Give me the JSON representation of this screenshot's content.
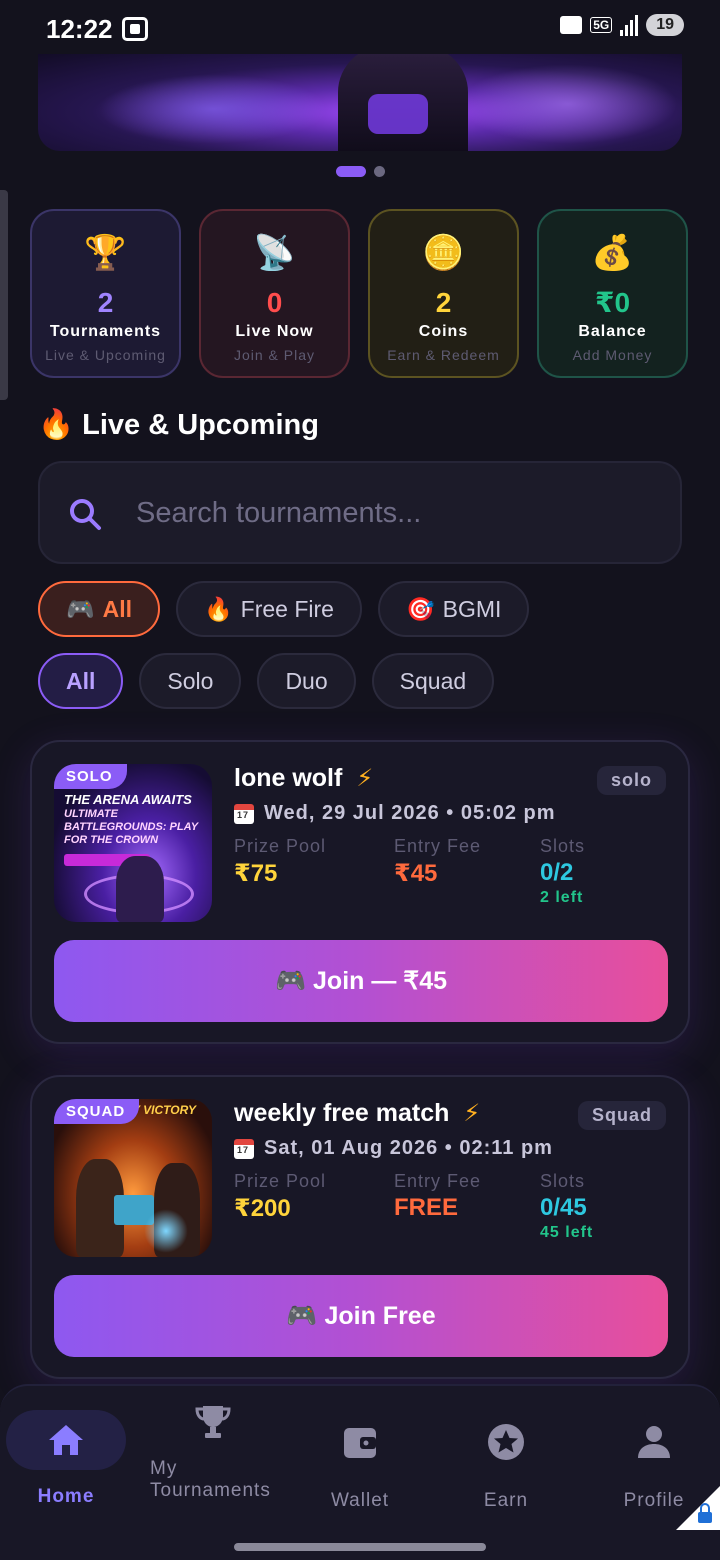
{
  "status_bar": {
    "time": "12:22",
    "network": "5G",
    "battery": "19"
  },
  "banner": {
    "slide_count": 2,
    "active_slide": 1
  },
  "stats": [
    {
      "icon": "trophy-icon",
      "emoji": "🏆",
      "value": "2",
      "label": "Tournaments",
      "sub": "Live & Upcoming",
      "color": "#a084ff"
    },
    {
      "icon": "satellite-icon",
      "emoji": "📡",
      "value": "0",
      "label": "Live Now",
      "sub": "Join & Play",
      "color": "#ff4d4d"
    },
    {
      "icon": "coin-icon",
      "emoji": "🪙",
      "value": "2",
      "label": "Coins",
      "sub": "Earn & Redeem",
      "color": "#ffd43b"
    },
    {
      "icon": "money-bag-icon",
      "emoji": "💰",
      "value": "₹0",
      "label": "Balance",
      "sub": "Add Money",
      "color": "#22c58b"
    }
  ],
  "section": {
    "emoji": "🔥",
    "title": "Live & Upcoming"
  },
  "search": {
    "placeholder": "Search tournaments..."
  },
  "game_filters": [
    {
      "emoji": "🎮",
      "label": "All",
      "active": true
    },
    {
      "emoji": "🔥",
      "label": "Free Fire",
      "active": false
    },
    {
      "emoji": "🎯",
      "label": "BGMI",
      "active": false
    }
  ],
  "mode_filters": [
    {
      "label": "All",
      "active": true
    },
    {
      "label": "Solo",
      "active": false
    },
    {
      "label": "Duo",
      "active": false
    },
    {
      "label": "Squad",
      "active": false
    }
  ],
  "tournaments": [
    {
      "name": "lone wolf",
      "mode_badge": "SOLO",
      "mode_tag": "solo",
      "thumb_line1": "THE ARENA AWAITS",
      "thumb_line2": "ULTIMATE BATTLEGROUNDS: PLAY FOR THE CROWN",
      "date": "Wed, 29 Jul 2026 • 05:02 pm",
      "prize_label": "Prize Pool",
      "prize": "₹75",
      "fee_label": "Entry Fee",
      "fee": "₹45",
      "slots_label": "Slots",
      "slots": "0/2",
      "slots_left": "2 left",
      "join_label": "🎮 Join — ₹45"
    },
    {
      "name": "weekly free match",
      "mode_badge": "SQUAD",
      "mode_tag": "Squad",
      "thumb_line1": "Y VICTORY",
      "thumb_line2": "",
      "date": "Sat, 01 Aug 2026 • 02:11 pm",
      "prize_label": "Prize Pool",
      "prize": "₹200",
      "fee_label": "Entry Fee",
      "fee": "FREE",
      "slots_label": "Slots",
      "slots": "0/45",
      "slots_left": "45 left",
      "join_label": "🎮 Join Free"
    }
  ],
  "bottom_nav": [
    {
      "icon": "home-icon",
      "label": "Home",
      "active": true
    },
    {
      "icon": "trophy-icon",
      "label": "My Tournaments",
      "active": false
    },
    {
      "icon": "wallet-icon",
      "label": "Wallet",
      "active": false
    },
    {
      "icon": "star-icon",
      "label": "Earn",
      "active": false
    },
    {
      "icon": "user-icon",
      "label": "Profile",
      "active": false
    }
  ]
}
